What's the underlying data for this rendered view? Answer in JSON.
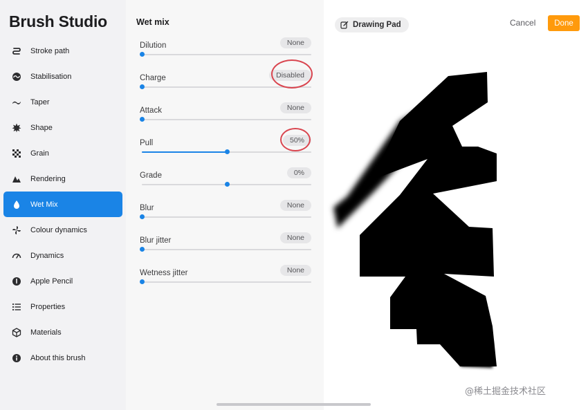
{
  "app_title": "Brush Studio",
  "sidebar": {
    "items": [
      {
        "label": "Stroke path",
        "icon": "stroke-path-icon"
      },
      {
        "label": "Stabilisation",
        "icon": "stabilisation-icon"
      },
      {
        "label": "Taper",
        "icon": "taper-icon"
      },
      {
        "label": "Shape",
        "icon": "shape-icon"
      },
      {
        "label": "Grain",
        "icon": "grain-icon"
      },
      {
        "label": "Rendering",
        "icon": "rendering-icon"
      },
      {
        "label": "Wet Mix",
        "icon": "water-drop-icon",
        "active": true
      },
      {
        "label": "Colour dynamics",
        "icon": "colour-dynamics-icon"
      },
      {
        "label": "Dynamics",
        "icon": "speedometer-icon"
      },
      {
        "label": "Apple Pencil",
        "icon": "apple-pencil-icon"
      },
      {
        "label": "Properties",
        "icon": "list-icon"
      },
      {
        "label": "Materials",
        "icon": "cube-icon"
      },
      {
        "label": "About this brush",
        "icon": "info-icon"
      }
    ]
  },
  "panel": {
    "title": "Wet mix",
    "settings": [
      {
        "label": "Dilution",
        "value": "None",
        "level": 0.0
      },
      {
        "label": "Charge",
        "value": "Disabled",
        "level": 0.0,
        "annotated": true
      },
      {
        "label": "Attack",
        "value": "None",
        "level": 0.0
      },
      {
        "label": "Pull",
        "value": "50%",
        "level": 0.5,
        "annotated": true
      },
      {
        "label": "Grade",
        "value": "0%",
        "level": 0.5,
        "centered": true
      },
      {
        "label": "Blur",
        "value": "None",
        "level": 0.0
      },
      {
        "label": "Blur jitter",
        "value": "None",
        "level": 0.0
      },
      {
        "label": "Wetness jitter",
        "value": "None",
        "level": 0.0
      }
    ]
  },
  "canvas": {
    "drawing_pad_label": "Drawing Pad",
    "cancel_label": "Cancel",
    "done_label": "Done"
  },
  "watermark": "@稀土掘金技术社区",
  "colors": {
    "accent": "#1a84e6",
    "done": "#ff9a0c",
    "annotation": "#d9454f",
    "stroke": "#000000"
  }
}
